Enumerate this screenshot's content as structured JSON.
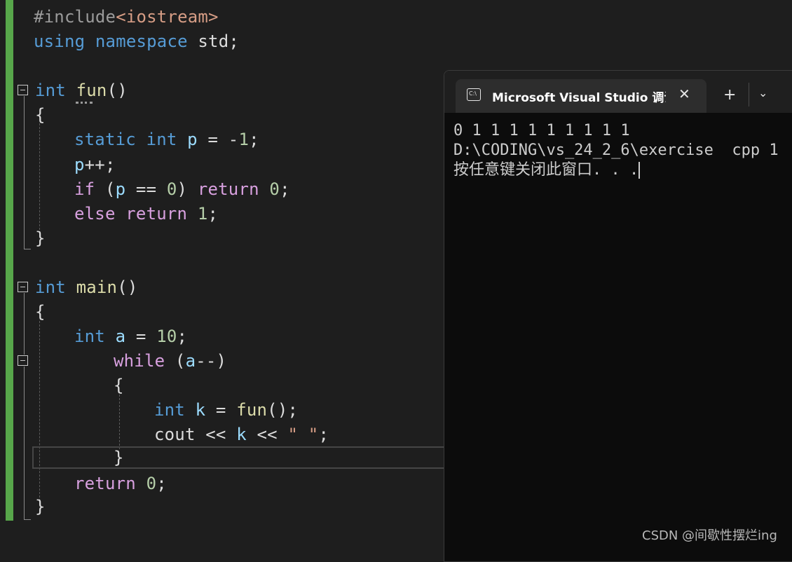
{
  "editor": {
    "lines": [
      {
        "tokens": [
          {
            "t": "#include",
            "c": "pp"
          },
          {
            "t": "<iostream>",
            "c": "str"
          }
        ]
      },
      {
        "tokens": [
          {
            "t": "using",
            "c": "kw"
          },
          {
            "t": " ",
            "c": "pl"
          },
          {
            "t": "namespace",
            "c": "kw"
          },
          {
            "t": " std;",
            "c": "pl"
          }
        ]
      },
      {
        "tokens": [
          {
            "t": "int",
            "c": "kw"
          },
          {
            "t": " ",
            "c": "pl"
          },
          {
            "t": "fun",
            "c": "fn"
          },
          {
            "t": "()",
            "c": "pl"
          }
        ]
      },
      {
        "tokens": [
          {
            "t": "{",
            "c": "pl"
          }
        ]
      },
      {
        "tokens": [
          {
            "t": "static",
            "c": "kw"
          },
          {
            "t": " ",
            "c": "pl"
          },
          {
            "t": "int",
            "c": "kw"
          },
          {
            "t": " ",
            "c": "pl"
          },
          {
            "t": "p",
            "c": "var"
          },
          {
            "t": " = -",
            "c": "pl"
          },
          {
            "t": "1",
            "c": "num"
          },
          {
            "t": ";",
            "c": "pl"
          }
        ]
      },
      {
        "tokens": [
          {
            "t": "p",
            "c": "var"
          },
          {
            "t": "++;",
            "c": "pl"
          }
        ]
      },
      {
        "tokens": [
          {
            "t": "if",
            "c": "ctl"
          },
          {
            "t": " (",
            "c": "pl"
          },
          {
            "t": "p",
            "c": "var"
          },
          {
            "t": " == ",
            "c": "pl"
          },
          {
            "t": "0",
            "c": "num"
          },
          {
            "t": ") ",
            "c": "pl"
          },
          {
            "t": "return",
            "c": "ctl"
          },
          {
            "t": " ",
            "c": "pl"
          },
          {
            "t": "0",
            "c": "num"
          },
          {
            "t": ";",
            "c": "pl"
          }
        ]
      },
      {
        "tokens": [
          {
            "t": "else",
            "c": "ctl"
          },
          {
            "t": " ",
            "c": "pl"
          },
          {
            "t": "return",
            "c": "ctl"
          },
          {
            "t": " ",
            "c": "pl"
          },
          {
            "t": "1",
            "c": "num"
          },
          {
            "t": ";",
            "c": "pl"
          }
        ]
      },
      {
        "tokens": [
          {
            "t": "}",
            "c": "pl"
          }
        ]
      },
      {
        "tokens": [
          {
            "t": "int",
            "c": "kw"
          },
          {
            "t": " ",
            "c": "pl"
          },
          {
            "t": "main",
            "c": "fn"
          },
          {
            "t": "()",
            "c": "pl"
          }
        ]
      },
      {
        "tokens": [
          {
            "t": "{",
            "c": "pl"
          }
        ]
      },
      {
        "tokens": [
          {
            "t": "int",
            "c": "kw"
          },
          {
            "t": " ",
            "c": "pl"
          },
          {
            "t": "a",
            "c": "var"
          },
          {
            "t": " = ",
            "c": "pl"
          },
          {
            "t": "10",
            "c": "num"
          },
          {
            "t": ";",
            "c": "pl"
          }
        ]
      },
      {
        "tokens": [
          {
            "t": "while",
            "c": "ctl"
          },
          {
            "t": " (",
            "c": "pl"
          },
          {
            "t": "a",
            "c": "var"
          },
          {
            "t": "--)",
            "c": "pl"
          }
        ]
      },
      {
        "tokens": [
          {
            "t": "{",
            "c": "pl"
          }
        ]
      },
      {
        "tokens": [
          {
            "t": "int",
            "c": "kw"
          },
          {
            "t": " ",
            "c": "pl"
          },
          {
            "t": "k",
            "c": "var"
          },
          {
            "t": " = ",
            "c": "pl"
          },
          {
            "t": "fun",
            "c": "fn"
          },
          {
            "t": "();",
            "c": "pl"
          }
        ]
      },
      {
        "tokens": [
          {
            "t": "cout",
            "c": "pl"
          },
          {
            "t": " << ",
            "c": "pl"
          },
          {
            "t": "k",
            "c": "var"
          },
          {
            "t": " << ",
            "c": "pl"
          },
          {
            "t": "\" \"",
            "c": "str"
          },
          {
            "t": ";",
            "c": "pl"
          }
        ]
      },
      {
        "tokens": [
          {
            "t": "}",
            "c": "pl"
          }
        ]
      },
      {
        "tokens": [
          {
            "t": "return",
            "c": "ctl"
          },
          {
            "t": " ",
            "c": "pl"
          },
          {
            "t": "0",
            "c": "num"
          },
          {
            "t": ";",
            "c": "pl"
          }
        ]
      },
      {
        "tokens": [
          {
            "t": "}",
            "c": "pl"
          }
        ]
      }
    ]
  },
  "colors": {
    "background": "#1e1e1e",
    "change_bar": "#57a64a",
    "keyword": "#569cd6",
    "control": "#d8a0df",
    "preprocessor": "#9b9b9b",
    "string": "#d69d85",
    "function": "#dcdcaa",
    "variable": "#9cdcfe",
    "number": "#b5cea8",
    "plain": "#dcdcdc",
    "terminal_bg": "#0c0c0c",
    "terminal_text": "#cccccc"
  },
  "terminal": {
    "tab_title": "Microsoft Visual Studio 调试控制台",
    "tab_icon_text": "C:\\",
    "close_glyph": "✕",
    "new_tab_glyph": "+",
    "dropdown_glyph": "⌄",
    "output_lines": [
      "0 1 1 1 1 1 1 1 1 1",
      "D:\\CODING\\vs_24_2_6\\exercise  cpp 1",
      "按任意键关闭此窗口. . ."
    ]
  },
  "watermark": "CSDN @间歇性摆烂ing"
}
